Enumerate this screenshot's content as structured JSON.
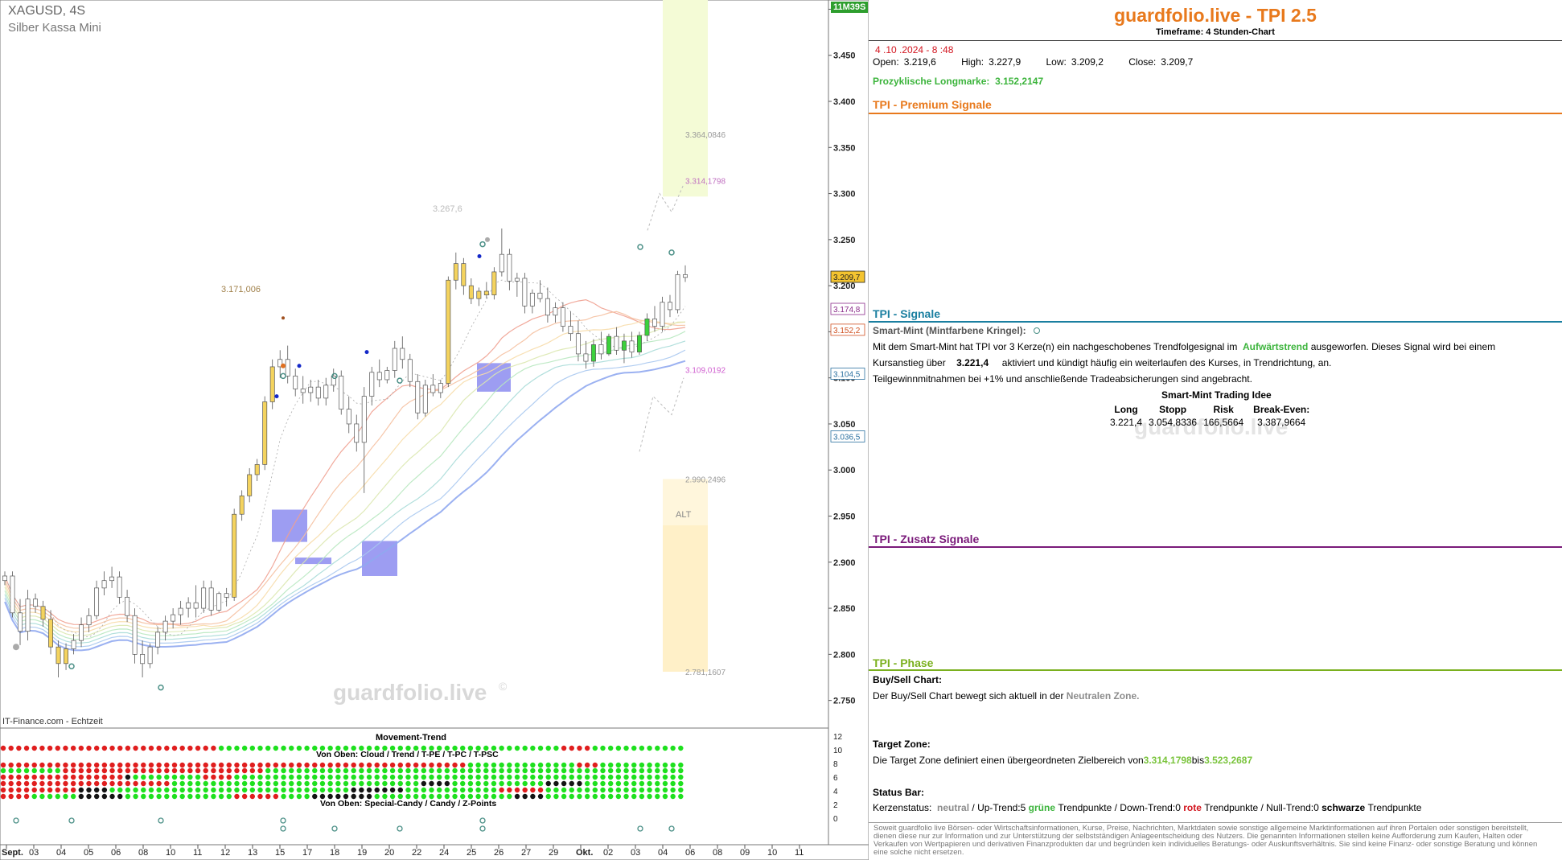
{
  "chart": {
    "symbol": "XAGUSD, 4S",
    "name": "Silber Kassa Mini",
    "timer": "11M39S",
    "source": "IT-Finance.com - Echtzeit",
    "watermark": "guardfolio.live",
    "alt_label": "ALT",
    "left_annotation": "3.171,006",
    "peak_annotation": "3.267,6"
  },
  "chart_data": {
    "type": "candlestick",
    "y_axis": {
      "min": 2.72,
      "max": 3.51,
      "ticks": [
        "3.500",
        "3.450",
        "3.400",
        "3.350",
        "3.300",
        "3.250",
        "3.200",
        "3.150",
        "3.100",
        "3.050",
        "3.000",
        "2.950",
        "2.900",
        "2.850",
        "2.800",
        "2.750"
      ]
    },
    "x_axis": {
      "tick_labels": [
        "Sept.",
        "03",
        "04",
        "05",
        "06",
        "08",
        "10",
        "11",
        "12",
        "13",
        "15",
        "17",
        "18",
        "19",
        "20",
        "22",
        "24",
        "25",
        "26",
        "27",
        "29",
        "Okt.",
        "02",
        "03",
        "04",
        "06",
        "08",
        "09",
        "10",
        "11"
      ]
    },
    "ohlc": [
      [
        2.88,
        2.89,
        2.875,
        2.885
      ],
      [
        2.885,
        2.89,
        2.84,
        2.845
      ],
      [
        2.845,
        2.86,
        2.81,
        2.825
      ],
      [
        2.825,
        2.87,
        2.815,
        2.86
      ],
      [
        2.86,
        2.866,
        2.845,
        2.852
      ],
      [
        2.852,
        2.858,
        2.83,
        2.838
      ],
      [
        2.838,
        2.848,
        2.8,
        2.808
      ],
      [
        2.808,
        2.815,
        2.775,
        2.79
      ],
      [
        2.79,
        2.812,
        2.783,
        2.806
      ],
      [
        2.806,
        2.822,
        2.8,
        2.815
      ],
      [
        2.815,
        2.84,
        2.808,
        2.832
      ],
      [
        2.832,
        2.85,
        2.824,
        2.842
      ],
      [
        2.842,
        2.88,
        2.838,
        2.872
      ],
      [
        2.872,
        2.89,
        2.864,
        2.88
      ],
      [
        2.88,
        2.895,
        2.872,
        2.884
      ],
      [
        2.884,
        2.89,
        2.855,
        2.862
      ],
      [
        2.862,
        2.87,
        2.835,
        2.842
      ],
      [
        2.842,
        2.85,
        2.79,
        2.8
      ],
      [
        2.8,
        2.815,
        2.775,
        2.79
      ],
      [
        2.79,
        2.812,
        2.785,
        2.808
      ],
      [
        2.808,
        2.83,
        2.8,
        2.824
      ],
      [
        2.824,
        2.842,
        2.815,
        2.836
      ],
      [
        2.836,
        2.85,
        2.828,
        2.843
      ],
      [
        2.843,
        2.858,
        2.832,
        2.85
      ],
      [
        2.85,
        2.862,
        2.84,
        2.856
      ],
      [
        2.856,
        2.875,
        2.84,
        2.85
      ],
      [
        2.85,
        2.88,
        2.845,
        2.872
      ],
      [
        2.872,
        2.88,
        2.842,
        2.848
      ],
      [
        2.848,
        2.868,
        2.846,
        2.866
      ],
      [
        2.866,
        2.872,
        2.852,
        2.862
      ],
      [
        2.862,
        2.958,
        2.858,
        2.952
      ],
      [
        2.952,
        2.978,
        2.945,
        2.972
      ],
      [
        2.972,
        3.002,
        2.965,
        2.995
      ],
      [
        2.995,
        3.012,
        2.988,
        3.006
      ],
      [
        3.006,
        3.08,
        3.0,
        3.074
      ],
      [
        3.074,
        3.12,
        3.066,
        3.112
      ],
      [
        3.112,
        3.13,
        3.1,
        3.12
      ],
      [
        3.12,
        3.135,
        3.094,
        3.102
      ],
      [
        3.102,
        3.11,
        3.08,
        3.088
      ],
      [
        3.088,
        3.102,
        3.072,
        3.084
      ],
      [
        3.084,
        3.098,
        3.074,
        3.09
      ],
      [
        3.09,
        3.098,
        3.07,
        3.078
      ],
      [
        3.078,
        3.1,
        3.07,
        3.092
      ],
      [
        3.092,
        3.11,
        3.085,
        3.102
      ],
      [
        3.102,
        3.108,
        3.06,
        3.066
      ],
      [
        3.066,
        3.08,
        3.04,
        3.05
      ],
      [
        3.05,
        3.06,
        3.02,
        3.03
      ],
      [
        3.03,
        3.09,
        2.975,
        3.08
      ],
      [
        3.08,
        3.112,
        3.07,
        3.106
      ],
      [
        3.106,
        3.12,
        3.09,
        3.098
      ],
      [
        3.098,
        3.112,
        3.094,
        3.108
      ],
      [
        3.108,
        3.14,
        3.1,
        3.132
      ],
      [
        3.132,
        3.145,
        3.11,
        3.12
      ],
      [
        3.12,
        3.126,
        3.09,
        3.096
      ],
      [
        3.096,
        3.104,
        3.055,
        3.062
      ],
      [
        3.062,
        3.098,
        3.058,
        3.092
      ],
      [
        3.092,
        3.104,
        3.08,
        3.084
      ],
      [
        3.084,
        3.098,
        3.078,
        3.094
      ],
      [
        3.094,
        3.21,
        3.09,
        3.206
      ],
      [
        3.206,
        3.236,
        3.196,
        3.224
      ],
      [
        3.224,
        3.23,
        3.19,
        3.2
      ],
      [
        3.2,
        3.208,
        3.18,
        3.186
      ],
      [
        3.186,
        3.198,
        3.178,
        3.194
      ],
      [
        3.194,
        3.204,
        3.186,
        3.19
      ],
      [
        3.19,
        3.22,
        3.185,
        3.215
      ],
      [
        3.215,
        3.262,
        3.21,
        3.234
      ],
      [
        3.234,
        3.24,
        3.195,
        3.205
      ],
      [
        3.205,
        3.214,
        3.188,
        3.208
      ],
      [
        3.208,
        3.214,
        3.17,
        3.178
      ],
      [
        3.178,
        3.196,
        3.17,
        3.192
      ],
      [
        3.192,
        3.206,
        3.182,
        3.186
      ],
      [
        3.186,
        3.198,
        3.16,
        3.168
      ],
      [
        3.168,
        3.182,
        3.16,
        3.176
      ],
      [
        3.176,
        3.182,
        3.15,
        3.156
      ],
      [
        3.156,
        3.172,
        3.14,
        3.148
      ],
      [
        3.148,
        3.162,
        3.118,
        3.126
      ],
      [
        3.126,
        3.14,
        3.11,
        3.118
      ],
      [
        3.118,
        3.142,
        3.112,
        3.136
      ],
      [
        3.136,
        3.15,
        3.12,
        3.126
      ],
      [
        3.126,
        3.148,
        3.124,
        3.145
      ],
      [
        3.145,
        3.155,
        3.125,
        3.13
      ],
      [
        3.13,
        3.148,
        3.116,
        3.14
      ],
      [
        3.14,
        3.15,
        3.122,
        3.128
      ],
      [
        3.128,
        3.15,
        3.125,
        3.146
      ],
      [
        3.146,
        3.17,
        3.14,
        3.164
      ],
      [
        3.164,
        3.178,
        3.15,
        3.156
      ],
      [
        3.156,
        3.188,
        3.15,
        3.182
      ],
      [
        3.182,
        3.19,
        3.166,
        3.174
      ],
      [
        3.174,
        3.216,
        3.17,
        3.212
      ],
      [
        3.212,
        3.222,
        3.204,
        3.209
      ]
    ],
    "indicator_lines": {
      "target_top": 3.5232687,
      "target_upper": 3.3640846,
      "target_zone_start": 3.3141798,
      "stop_level": 3.1090192,
      "lower_zone_top": 2.9902496,
      "lower_zone_bottom": 2.7811607
    },
    "price_labels": [
      "3.209,7",
      "3.174,8",
      "3.152,2",
      "3.104,5",
      "3.036,5"
    ],
    "level_labels": [
      "3.523,2687",
      "3.364,0846",
      "3.314,1798",
      "3.109,0192",
      "2.990,2496",
      "2.781,1607"
    ]
  },
  "lower_panel": {
    "title": "Movement-Trend",
    "subtitle1": "Von Oben: Cloud / Trend / T-PE / T-PC / T-PSC",
    "subtitle2": "Von Oben: Special-Candy / Candy / Z-Points",
    "axis_ticks": [
      "12",
      "10",
      "8",
      "6",
      "4",
      "2",
      "0"
    ]
  },
  "panel": {
    "brand": "guardfolio.live - TPI 2.5",
    "timeframe": "Timeframe: 4 Stunden-Chart",
    "datetime": "4 .10 .2024  - 8 :48",
    "ohlc_labels": {
      "open": "Open:",
      "high": "High:",
      "low": "Low:",
      "close": "Close:"
    },
    "ohlc_values": {
      "open": "3.219,6",
      "high": "3.227,9",
      "low": "3.209,2",
      "close": "3.209,7"
    },
    "prozyklisch_label": "Prozyklische Longmarke:",
    "prozyklisch_value": "3.152,2147",
    "sec_premium": "TPI - Premium Signale",
    "sec_signale": "TPI - Signale",
    "smart_mint_label": "Smart-Mint (Mintfarbene Kringel):",
    "signal_line1_a": "Mit dem Smart-Mint hat TPI vor 3  Kerze(n) ein nachgeschobenes Trendfolgesignal im",
    "signal_line1_b": "Aufwärtstrend",
    "signal_line1_c": "ausgeworfen. Dieses Signal wird bei einem",
    "signal_line2_a": "Kursanstieg über",
    "signal_line2_b": "3.221,4",
    "signal_line2_c": "aktiviert und kündigt häufig ein weiterlaufen des Kurses, in Trendrichtung, an.",
    "signal_line3": "Teilgewinnmitnahmen bei +1% und anschließende Tradeabsicherungen sind angebracht.",
    "idea_title": "Smart-Mint Trading Idee",
    "idea_headers": [
      "Long",
      "Stopp",
      "Risk",
      "Break-Even:"
    ],
    "idea_values": [
      "3.221,4",
      "3.054,8336",
      "166,5664",
      "3.387,9664"
    ],
    "sec_zusatz": "TPI - Zusatz Signale",
    "sec_phase": "TPI - Phase",
    "buysell_label": "Buy/Sell Chart:",
    "buysell_a": "Der Buy/Sell Chart bewegt sich aktuell in der",
    "buysell_b": "Neutralen Zone.",
    "target_label": "Target Zone:",
    "target_a": "Die Target Zone definiert einen übergeordneten Zielbereich von",
    "target_b": "3.314,1798",
    "target_c": "bis",
    "target_d": "3.523,2687",
    "status_label": "Status Bar:",
    "status_a": "Kerzenstatus:",
    "status_b": "neutral",
    "status_c": " / Up-Trend:5",
    "status_d": "grüne",
    "status_e": "Trendpunkte  / Down-Trend:0",
    "status_f": "rote",
    "status_g": "Trendpunkte / Null-Trend:0",
    "status_h": "schwarze",
    "status_i": "Trendpunkte",
    "disclaimer": "Soweit guardfolio live Börsen- oder Wirtschaftsinformationen, Kurse, Preise, Nachrichten, Marktdaten sowie sonstige allgemeine Marktinformationen auf ihren Portalen oder sonstigen bereitstellt, dienen diese nur zur Information und zur Unterstützung der selbstständigen Anlageentscheidung des Nutzers. Die genannten Informationen stellen keine Aufforderung zum Kaufen, Halten oder Verkaufen von Wertpapieren und derivativen Finanzprodukten dar und begründen kein individuelles Beratungs- oder Auskunftsverhältnis. Sie sind keine Finanz- oder sonstige Beratung und können eine solche nicht ersetzen.",
    "panel_watermark": "guardfolio.live"
  },
  "colors": {
    "brand": "#e8791c",
    "premium_line": "#e8791c",
    "signale_line": "#1a7fa0",
    "zusatz_line": "#7a1a7a",
    "phase_line": "#7ab01e",
    "bull": "#ffffff",
    "bear": "#ffffff",
    "dot_green": "#1ee01e",
    "dot_red": "#e01e1e",
    "dot_black": "#141414"
  }
}
